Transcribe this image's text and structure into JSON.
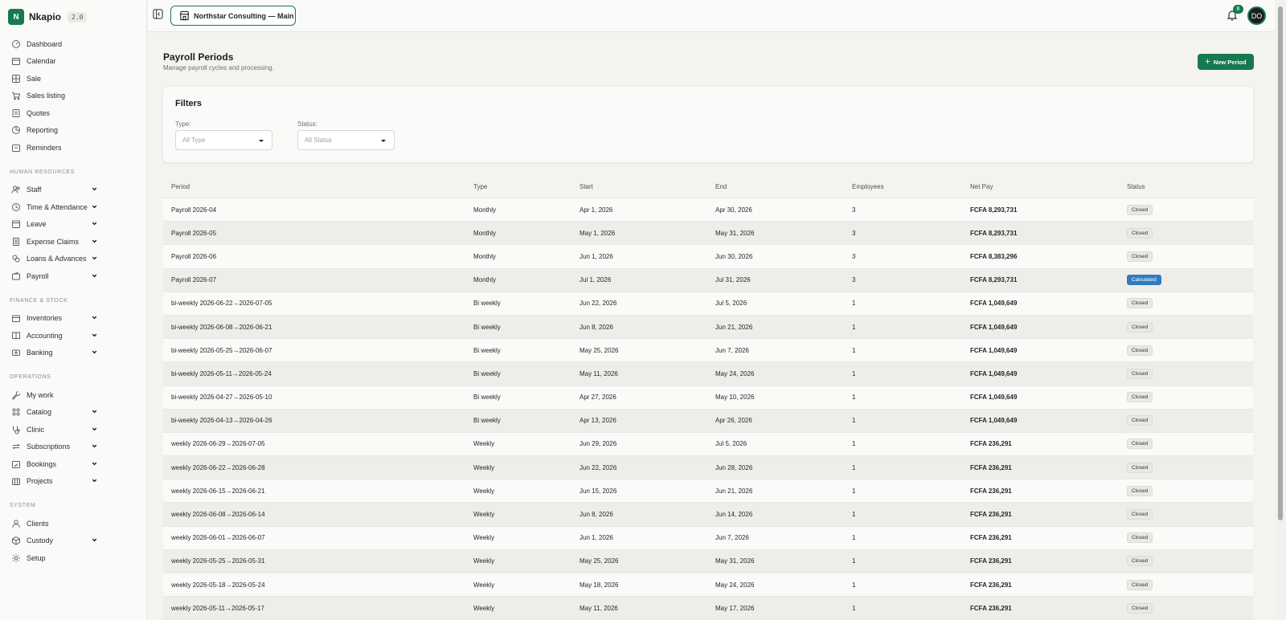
{
  "app": {
    "name": "Nkapio",
    "version": "2.0"
  },
  "topbar": {
    "org": "Northstar Consulting — Main",
    "notifications": "8",
    "avatar": "DO"
  },
  "sidebar": {
    "top": [
      {
        "label": "Dashboard",
        "icon": "dashboard-icon"
      },
      {
        "label": "Calendar",
        "icon": "calendar-icon"
      },
      {
        "label": "Sale",
        "icon": "sale-icon"
      },
      {
        "label": "Sales listing",
        "icon": "cart-icon"
      },
      {
        "label": "Quotes",
        "icon": "quote-icon"
      },
      {
        "label": "Reporting",
        "icon": "pie-chart-icon"
      },
      {
        "label": "Reminders",
        "icon": "reminder-icon"
      }
    ],
    "hr_title": "HUMAN RESOURCES",
    "hr": [
      {
        "label": "Staff",
        "icon": "users-icon"
      },
      {
        "label": "Time & Attendance",
        "icon": "clock-icon"
      },
      {
        "label": "Leave",
        "icon": "leave-icon"
      },
      {
        "label": "Expense Claims",
        "icon": "receipt-icon"
      },
      {
        "label": "Loans & Advances",
        "icon": "coins-icon"
      },
      {
        "label": "Payroll",
        "icon": "wallet-icon"
      }
    ],
    "fin_title": "FINANCE & STOCK",
    "fin": [
      {
        "label": "Inventories",
        "icon": "box-icon"
      },
      {
        "label": "Accounting",
        "icon": "book-icon"
      },
      {
        "label": "Banking",
        "icon": "bank-icon"
      }
    ],
    "ops_title": "OPERATIONS",
    "ops": [
      {
        "label": "My work",
        "icon": "wrench-icon",
        "chevron": false
      },
      {
        "label": "Catalog",
        "icon": "catalog-icon",
        "chevron": true
      },
      {
        "label": "Clinic",
        "icon": "stethoscope-icon",
        "chevron": true
      },
      {
        "label": "Subscriptions",
        "icon": "repeat-icon",
        "chevron": true
      },
      {
        "label": "Bookings",
        "icon": "calendar-check-icon",
        "chevron": true
      },
      {
        "label": "Projects",
        "icon": "projects-icon",
        "chevron": true
      }
    ],
    "sys_title": "SYSTEM",
    "sys": [
      {
        "label": "Clients",
        "icon": "user-icon",
        "chevron": false
      },
      {
        "label": "Custody",
        "icon": "package-icon",
        "chevron": true
      },
      {
        "label": "Setup",
        "icon": "gear-icon",
        "chevron": false
      }
    ]
  },
  "page": {
    "title": "Payroll Periods",
    "subtitle": "Manage payroll cycles and processing.",
    "new_button": "New Period"
  },
  "filters": {
    "title": "Filters",
    "type_label": "Type:",
    "type_value": "All Type",
    "status_label": "Status:",
    "status_value": "All Status"
  },
  "table": {
    "headers": [
      "Period",
      "Type",
      "Start",
      "End",
      "Employees",
      "Net Pay",
      "Status"
    ],
    "rows": [
      [
        "Payroll 2026-04",
        "Monthly",
        "Apr 1, 2026",
        "Apr 30, 2026",
        "3",
        "FCFA 8,293,731",
        "Closed"
      ],
      [
        "Payroll 2026-05",
        "Monthly",
        "May 1, 2026",
        "May 31, 2026",
        "3",
        "FCFA 8,293,731",
        "Closed"
      ],
      [
        "Payroll 2026-06",
        "Monthly",
        "Jun 1, 2026",
        "Jun 30, 2026",
        "3",
        "FCFA 8,383,296",
        "Closed"
      ],
      [
        "Payroll 2026-07",
        "Monthly",
        "Jul 1, 2026",
        "Jul 31, 2026",
        "3",
        "FCFA 8,293,731",
        "Calculated"
      ],
      [
        "bi-weekly 2026-06-22→2026-07-05",
        "Bi weekly",
        "Jun 22, 2026",
        "Jul 5, 2026",
        "1",
        "FCFA 1,049,649",
        "Closed"
      ],
      [
        "bi-weekly 2026-06-08→2026-06-21",
        "Bi weekly",
        "Jun 8, 2026",
        "Jun 21, 2026",
        "1",
        "FCFA 1,049,649",
        "Closed"
      ],
      [
        "bi-weekly 2026-05-25→2026-06-07",
        "Bi weekly",
        "May 25, 2026",
        "Jun 7, 2026",
        "1",
        "FCFA 1,049,649",
        "Closed"
      ],
      [
        "bi-weekly 2026-05-11→2026-05-24",
        "Bi weekly",
        "May 11, 2026",
        "May 24, 2026",
        "1",
        "FCFA 1,049,649",
        "Closed"
      ],
      [
        "bi-weekly 2026-04-27→2026-05-10",
        "Bi weekly",
        "Apr 27, 2026",
        "May 10, 2026",
        "1",
        "FCFA 1,049,649",
        "Closed"
      ],
      [
        "bi-weekly 2026-04-13→2026-04-26",
        "Bi weekly",
        "Apr 13, 2026",
        "Apr 26, 2026",
        "1",
        "FCFA 1,049,649",
        "Closed"
      ],
      [
        "weekly 2026-06-29→2026-07-05",
        "Weekly",
        "Jun 29, 2026",
        "Jul 5, 2026",
        "1",
        "FCFA 236,291",
        "Closed"
      ],
      [
        "weekly 2026-06-22→2026-06-28",
        "Weekly",
        "Jun 22, 2026",
        "Jun 28, 2026",
        "1",
        "FCFA 236,291",
        "Closed"
      ],
      [
        "weekly 2026-06-15→2026-06-21",
        "Weekly",
        "Jun 15, 2026",
        "Jun 21, 2026",
        "1",
        "FCFA 236,291",
        "Closed"
      ],
      [
        "weekly 2026-06-08→2026-06-14",
        "Weekly",
        "Jun 8, 2026",
        "Jun 14, 2026",
        "1",
        "FCFA 236,291",
        "Closed"
      ],
      [
        "weekly 2026-06-01→2026-06-07",
        "Weekly",
        "Jun 1, 2026",
        "Jun 7, 2026",
        "1",
        "FCFA 236,291",
        "Closed"
      ],
      [
        "weekly 2026-05-25→2026-05-31",
        "Weekly",
        "May 25, 2026",
        "May 31, 2026",
        "1",
        "FCFA 236,291",
        "Closed"
      ],
      [
        "weekly 2026-05-18→2026-05-24",
        "Weekly",
        "May 18, 2026",
        "May 24, 2026",
        "1",
        "FCFA 236,291",
        "Closed"
      ],
      [
        "weekly 2026-05-11→2026-05-17",
        "Weekly",
        "May 11, 2026",
        "May 17, 2026",
        "1",
        "FCFA 236,291",
        "Closed"
      ]
    ]
  },
  "colors": {
    "accent": "#16794f",
    "calculated": "#2f7bc0"
  }
}
